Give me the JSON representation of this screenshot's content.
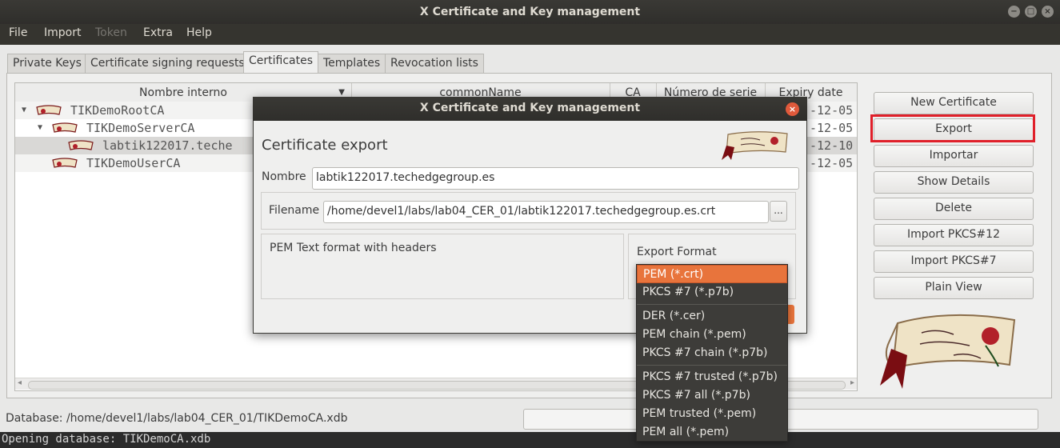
{
  "window": {
    "title": "X Certificate and Key management",
    "controls": {
      "minimize": "−",
      "maximize": "□",
      "close": "×"
    }
  },
  "menu": [
    "File",
    "Import",
    "Token",
    "Extra",
    "Help"
  ],
  "tabs": [
    "Private Keys",
    "Certificate signing requests",
    "Certificates",
    "Templates",
    "Revocation lists"
  ],
  "active_tab": "Certificates",
  "table": {
    "columns": [
      "Nombre interno",
      "commonName",
      "CA",
      "Número de serie",
      "Expiry date"
    ],
    "rows": [
      {
        "name": "TIKDemoRootCA",
        "expiry": "-12-05"
      },
      {
        "name": "TIKDemoServerCA",
        "expiry": "-12-05"
      },
      {
        "name": "labtik122017.teche",
        "expiry": "-12-10"
      },
      {
        "name": "TIKDemoUserCA",
        "expiry": "-12-05"
      }
    ]
  },
  "side_buttons": [
    "New Certificate",
    "Export",
    "Importar",
    "Show Details",
    "Delete",
    "Import PKCS#12",
    "Import PKCS#7",
    "Plain View"
  ],
  "status": {
    "database": "Database: /home/devel1/labs/lab04_CER_01/TIKDemoCA.xdb",
    "console": "Opening database: TIKDemoCA.xdb"
  },
  "dialog": {
    "title": "X Certificate and Key management",
    "heading": "Certificate export",
    "nombre_label": "Nombre",
    "nombre_value": "labtik122017.techedgegroup.es",
    "filename_label": "Filename",
    "filename_value": "/home/devel1/labs/lab04_CER_01/labtik122017.techedgegroup.es.crt",
    "browse_label": "...",
    "description": "PEM Text format with headers",
    "export_format_label": "Export Format",
    "selected_format": "PEM (*.crt)",
    "format_options": [
      "PEM (*.crt)",
      "PKCS #7 (*.p7b)",
      "DER (*.cer)",
      "PEM chain (*.pem)",
      "PKCS #7 chain (*.p7b)",
      "PKCS #7 trusted (*.p7b)",
      "PKCS #7 all (*.p7b)",
      "PEM trusted (*.pem)",
      "PEM all (*.pem)"
    ]
  },
  "colors": {
    "highlight_border": "#e0202a",
    "selected_option": "#e8743c"
  }
}
